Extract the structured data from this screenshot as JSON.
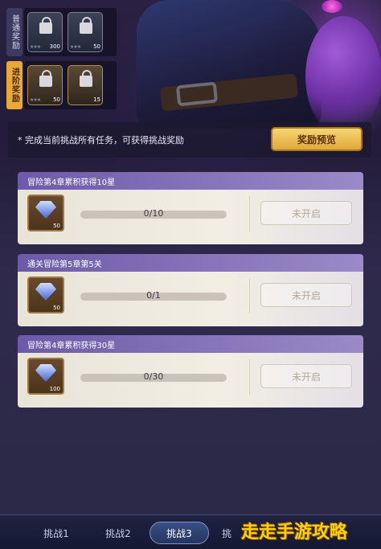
{
  "rewards": {
    "normal_label": "普通奖励",
    "advanced_label": "进阶奖励",
    "normal_items": [
      {
        "icon": "locked-chest-icon",
        "stars": "★★★",
        "count": "300"
      },
      {
        "icon": "locked-chest-icon",
        "stars": "★★★",
        "count": "50"
      }
    ],
    "advanced_items": [
      {
        "icon": "locked-chest-icon",
        "stars": "★★★",
        "count": "50"
      },
      {
        "icon": "locked-chest-icon",
        "stars": "",
        "count": "15"
      }
    ]
  },
  "info": {
    "text": "* 完成当前挑战所有任务，可获得挑战奖励",
    "preview_button": "奖励预览"
  },
  "tasks": [
    {
      "title": "冒险第4章累积获得10星",
      "reward_count": "50",
      "progress": "0/10",
      "status": "未开启"
    },
    {
      "title": "通关冒险第5章第5关",
      "reward_count": "50",
      "progress": "0/1",
      "status": "未开启"
    },
    {
      "title": "冒险第4章累积获得30星",
      "reward_count": "100",
      "progress": "0/30",
      "status": "未开启"
    }
  ],
  "tabs": [
    {
      "label": "挑战1"
    },
    {
      "label": "挑战2"
    },
    {
      "label": "挑战3",
      "active": true
    },
    {
      "label": "挑"
    }
  ],
  "watermark": "走走手游攻略",
  "colors": {
    "accent_gold": "#e0a93a",
    "header_purple": "#6d5aa8"
  }
}
